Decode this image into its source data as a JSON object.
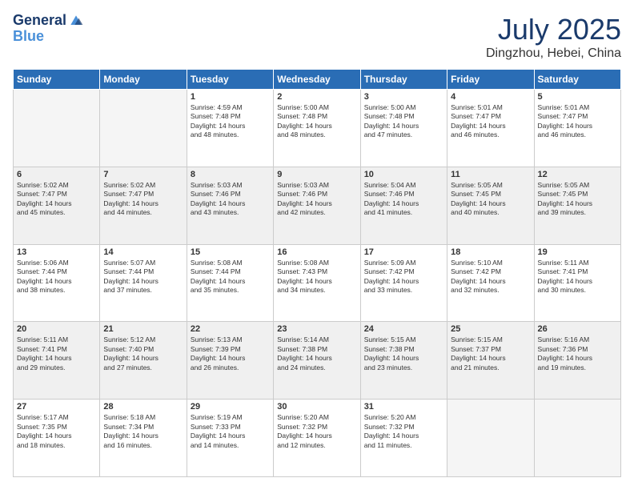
{
  "logo": {
    "line1": "General",
    "line2": "Blue"
  },
  "title": "July 2025",
  "subtitle": "Dingzhou, Hebei, China",
  "weekdays": [
    "Sunday",
    "Monday",
    "Tuesday",
    "Wednesday",
    "Thursday",
    "Friday",
    "Saturday"
  ],
  "weeks": [
    [
      {
        "day": "",
        "sunrise": "",
        "sunset": "",
        "daylight": ""
      },
      {
        "day": "",
        "sunrise": "",
        "sunset": "",
        "daylight": ""
      },
      {
        "day": "1",
        "sunrise": "Sunrise: 4:59 AM",
        "sunset": "Sunset: 7:48 PM",
        "daylight": "Daylight: 14 hours and 48 minutes."
      },
      {
        "day": "2",
        "sunrise": "Sunrise: 5:00 AM",
        "sunset": "Sunset: 7:48 PM",
        "daylight": "Daylight: 14 hours and 48 minutes."
      },
      {
        "day": "3",
        "sunrise": "Sunrise: 5:00 AM",
        "sunset": "Sunset: 7:48 PM",
        "daylight": "Daylight: 14 hours and 47 minutes."
      },
      {
        "day": "4",
        "sunrise": "Sunrise: 5:01 AM",
        "sunset": "Sunset: 7:47 PM",
        "daylight": "Daylight: 14 hours and 46 minutes."
      },
      {
        "day": "5",
        "sunrise": "Sunrise: 5:01 AM",
        "sunset": "Sunset: 7:47 PM",
        "daylight": "Daylight: 14 hours and 46 minutes."
      }
    ],
    [
      {
        "day": "6",
        "sunrise": "Sunrise: 5:02 AM",
        "sunset": "Sunset: 7:47 PM",
        "daylight": "Daylight: 14 hours and 45 minutes."
      },
      {
        "day": "7",
        "sunrise": "Sunrise: 5:02 AM",
        "sunset": "Sunset: 7:47 PM",
        "daylight": "Daylight: 14 hours and 44 minutes."
      },
      {
        "day": "8",
        "sunrise": "Sunrise: 5:03 AM",
        "sunset": "Sunset: 7:46 PM",
        "daylight": "Daylight: 14 hours and 43 minutes."
      },
      {
        "day": "9",
        "sunrise": "Sunrise: 5:03 AM",
        "sunset": "Sunset: 7:46 PM",
        "daylight": "Daylight: 14 hours and 42 minutes."
      },
      {
        "day": "10",
        "sunrise": "Sunrise: 5:04 AM",
        "sunset": "Sunset: 7:46 PM",
        "daylight": "Daylight: 14 hours and 41 minutes."
      },
      {
        "day": "11",
        "sunrise": "Sunrise: 5:05 AM",
        "sunset": "Sunset: 7:45 PM",
        "daylight": "Daylight: 14 hours and 40 minutes."
      },
      {
        "day": "12",
        "sunrise": "Sunrise: 5:05 AM",
        "sunset": "Sunset: 7:45 PM",
        "daylight": "Daylight: 14 hours and 39 minutes."
      }
    ],
    [
      {
        "day": "13",
        "sunrise": "Sunrise: 5:06 AM",
        "sunset": "Sunset: 7:44 PM",
        "daylight": "Daylight: 14 hours and 38 minutes."
      },
      {
        "day": "14",
        "sunrise": "Sunrise: 5:07 AM",
        "sunset": "Sunset: 7:44 PM",
        "daylight": "Daylight: 14 hours and 37 minutes."
      },
      {
        "day": "15",
        "sunrise": "Sunrise: 5:08 AM",
        "sunset": "Sunset: 7:44 PM",
        "daylight": "Daylight: 14 hours and 35 minutes."
      },
      {
        "day": "16",
        "sunrise": "Sunrise: 5:08 AM",
        "sunset": "Sunset: 7:43 PM",
        "daylight": "Daylight: 14 hours and 34 minutes."
      },
      {
        "day": "17",
        "sunrise": "Sunrise: 5:09 AM",
        "sunset": "Sunset: 7:42 PM",
        "daylight": "Daylight: 14 hours and 33 minutes."
      },
      {
        "day": "18",
        "sunrise": "Sunrise: 5:10 AM",
        "sunset": "Sunset: 7:42 PM",
        "daylight": "Daylight: 14 hours and 32 minutes."
      },
      {
        "day": "19",
        "sunrise": "Sunrise: 5:11 AM",
        "sunset": "Sunset: 7:41 PM",
        "daylight": "Daylight: 14 hours and 30 minutes."
      }
    ],
    [
      {
        "day": "20",
        "sunrise": "Sunrise: 5:11 AM",
        "sunset": "Sunset: 7:41 PM",
        "daylight": "Daylight: 14 hours and 29 minutes."
      },
      {
        "day": "21",
        "sunrise": "Sunrise: 5:12 AM",
        "sunset": "Sunset: 7:40 PM",
        "daylight": "Daylight: 14 hours and 27 minutes."
      },
      {
        "day": "22",
        "sunrise": "Sunrise: 5:13 AM",
        "sunset": "Sunset: 7:39 PM",
        "daylight": "Daylight: 14 hours and 26 minutes."
      },
      {
        "day": "23",
        "sunrise": "Sunrise: 5:14 AM",
        "sunset": "Sunset: 7:38 PM",
        "daylight": "Daylight: 14 hours and 24 minutes."
      },
      {
        "day": "24",
        "sunrise": "Sunrise: 5:15 AM",
        "sunset": "Sunset: 7:38 PM",
        "daylight": "Daylight: 14 hours and 23 minutes."
      },
      {
        "day": "25",
        "sunrise": "Sunrise: 5:15 AM",
        "sunset": "Sunset: 7:37 PM",
        "daylight": "Daylight: 14 hours and 21 minutes."
      },
      {
        "day": "26",
        "sunrise": "Sunrise: 5:16 AM",
        "sunset": "Sunset: 7:36 PM",
        "daylight": "Daylight: 14 hours and 19 minutes."
      }
    ],
    [
      {
        "day": "27",
        "sunrise": "Sunrise: 5:17 AM",
        "sunset": "Sunset: 7:35 PM",
        "daylight": "Daylight: 14 hours and 18 minutes."
      },
      {
        "day": "28",
        "sunrise": "Sunrise: 5:18 AM",
        "sunset": "Sunset: 7:34 PM",
        "daylight": "Daylight: 14 hours and 16 minutes."
      },
      {
        "day": "29",
        "sunrise": "Sunrise: 5:19 AM",
        "sunset": "Sunset: 7:33 PM",
        "daylight": "Daylight: 14 hours and 14 minutes."
      },
      {
        "day": "30",
        "sunrise": "Sunrise: 5:20 AM",
        "sunset": "Sunset: 7:32 PM",
        "daylight": "Daylight: 14 hours and 12 minutes."
      },
      {
        "day": "31",
        "sunrise": "Sunrise: 5:20 AM",
        "sunset": "Sunset: 7:32 PM",
        "daylight": "Daylight: 14 hours and 11 minutes."
      },
      {
        "day": "",
        "sunrise": "",
        "sunset": "",
        "daylight": ""
      },
      {
        "day": "",
        "sunrise": "",
        "sunset": "",
        "daylight": ""
      }
    ]
  ]
}
